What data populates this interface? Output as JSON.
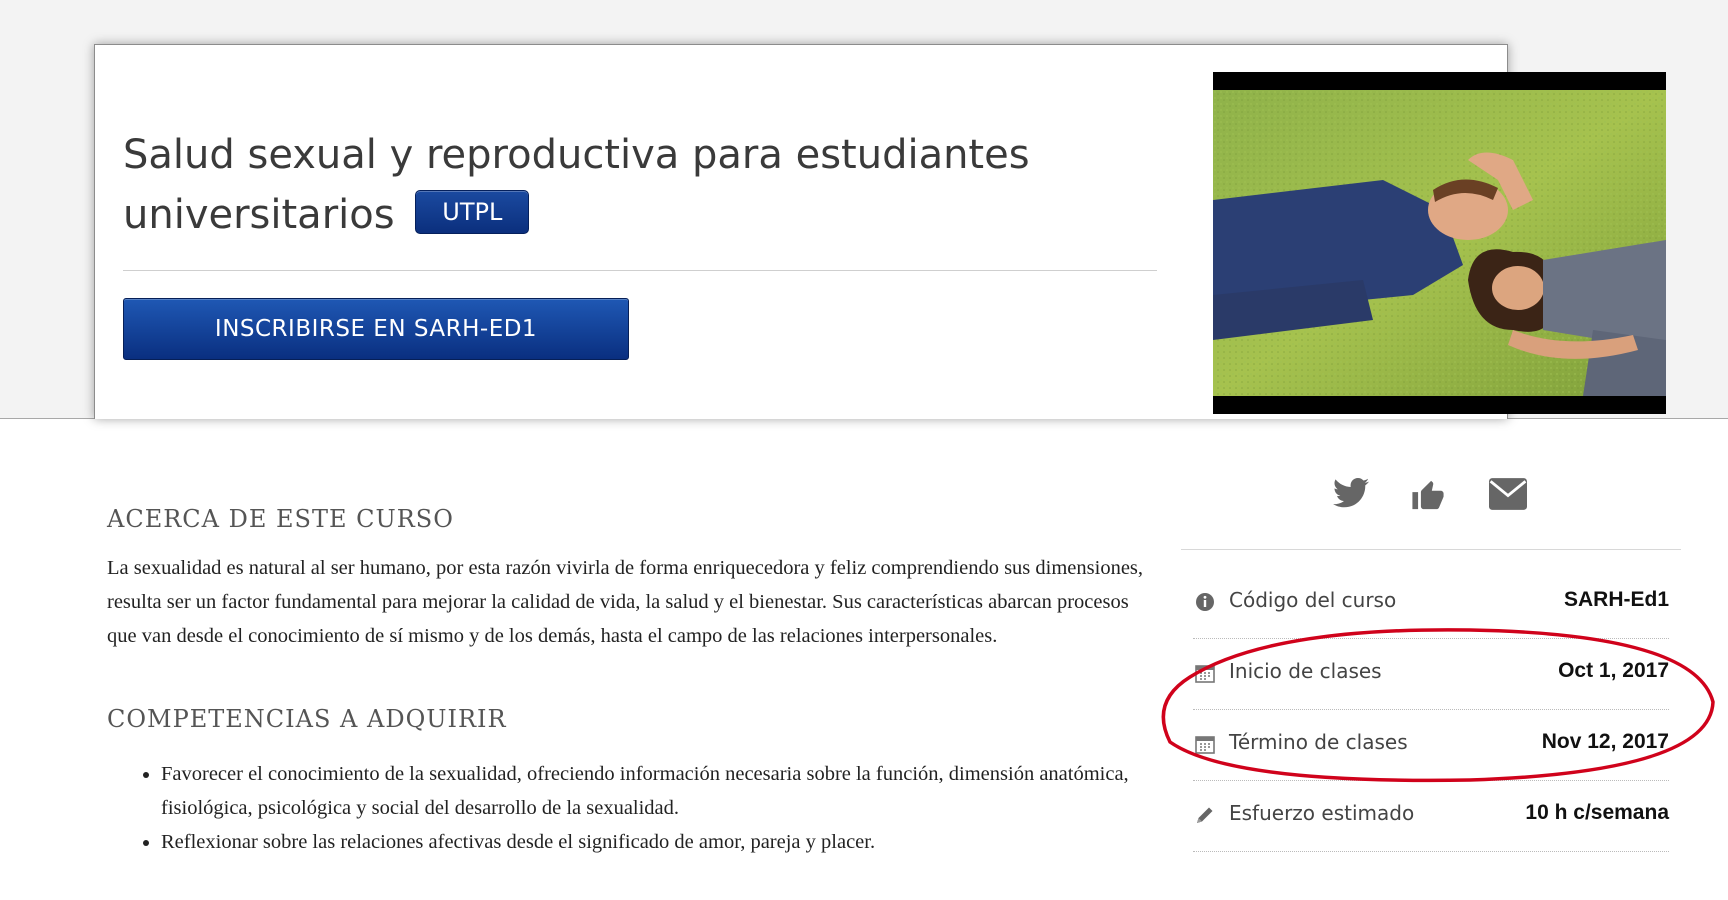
{
  "hero": {
    "title": "Salud sexual y reproductiva para estudiantes universitarios",
    "org_badge": "UTPL",
    "enroll_label": "INSCRIBIRSE EN SARH-ED1",
    "video_thumbnail": "couple-lying-on-grass-photo"
  },
  "about": {
    "heading": "ACERCA DE ESTE CURSO",
    "text": "La sexualidad es natural al ser humano, por esta razón vivirla de forma enriquecedora y feliz comprendiendo sus dimensiones, resulta ser un factor fundamental para mejorar la calidad de vida, la salud y el bienestar. Sus características abarcan procesos que van desde el conocimiento de sí mismo y de los demás, hasta el campo de las relaciones interpersonales."
  },
  "competencies": {
    "heading": "COMPETENCIAS A ADQUIRIR",
    "items": [
      "Favorecer el conocimiento de la sexualidad, ofreciendo información necesaria sobre la función, dimensión anatómica, fisiológica, psicológica y social del desarrollo de la sexualidad.",
      "Reflexionar sobre las relaciones afectivas desde el significado de amor, pareja y placer."
    ]
  },
  "share": {
    "icons": [
      "twitter-icon",
      "thumbs-up-icon",
      "envelope-icon"
    ]
  },
  "facts": [
    {
      "icon": "info-icon",
      "label": "Código del curso",
      "value": "SARH-Ed1"
    },
    {
      "icon": "calendar-icon",
      "label": "Inicio de clases",
      "value": "Oct 1, 2017"
    },
    {
      "icon": "calendar-icon",
      "label": "Término de clases",
      "value": "Nov 12, 2017"
    },
    {
      "icon": "pencil-icon",
      "label": "Esfuerzo estimado",
      "value": "10 h c/semana"
    }
  ],
  "colors": {
    "primary_blue": "#0b2f7d",
    "highlight_red": "#d0021b",
    "icon_gray": "#666666",
    "band_gray": "#f3f3f3"
  }
}
